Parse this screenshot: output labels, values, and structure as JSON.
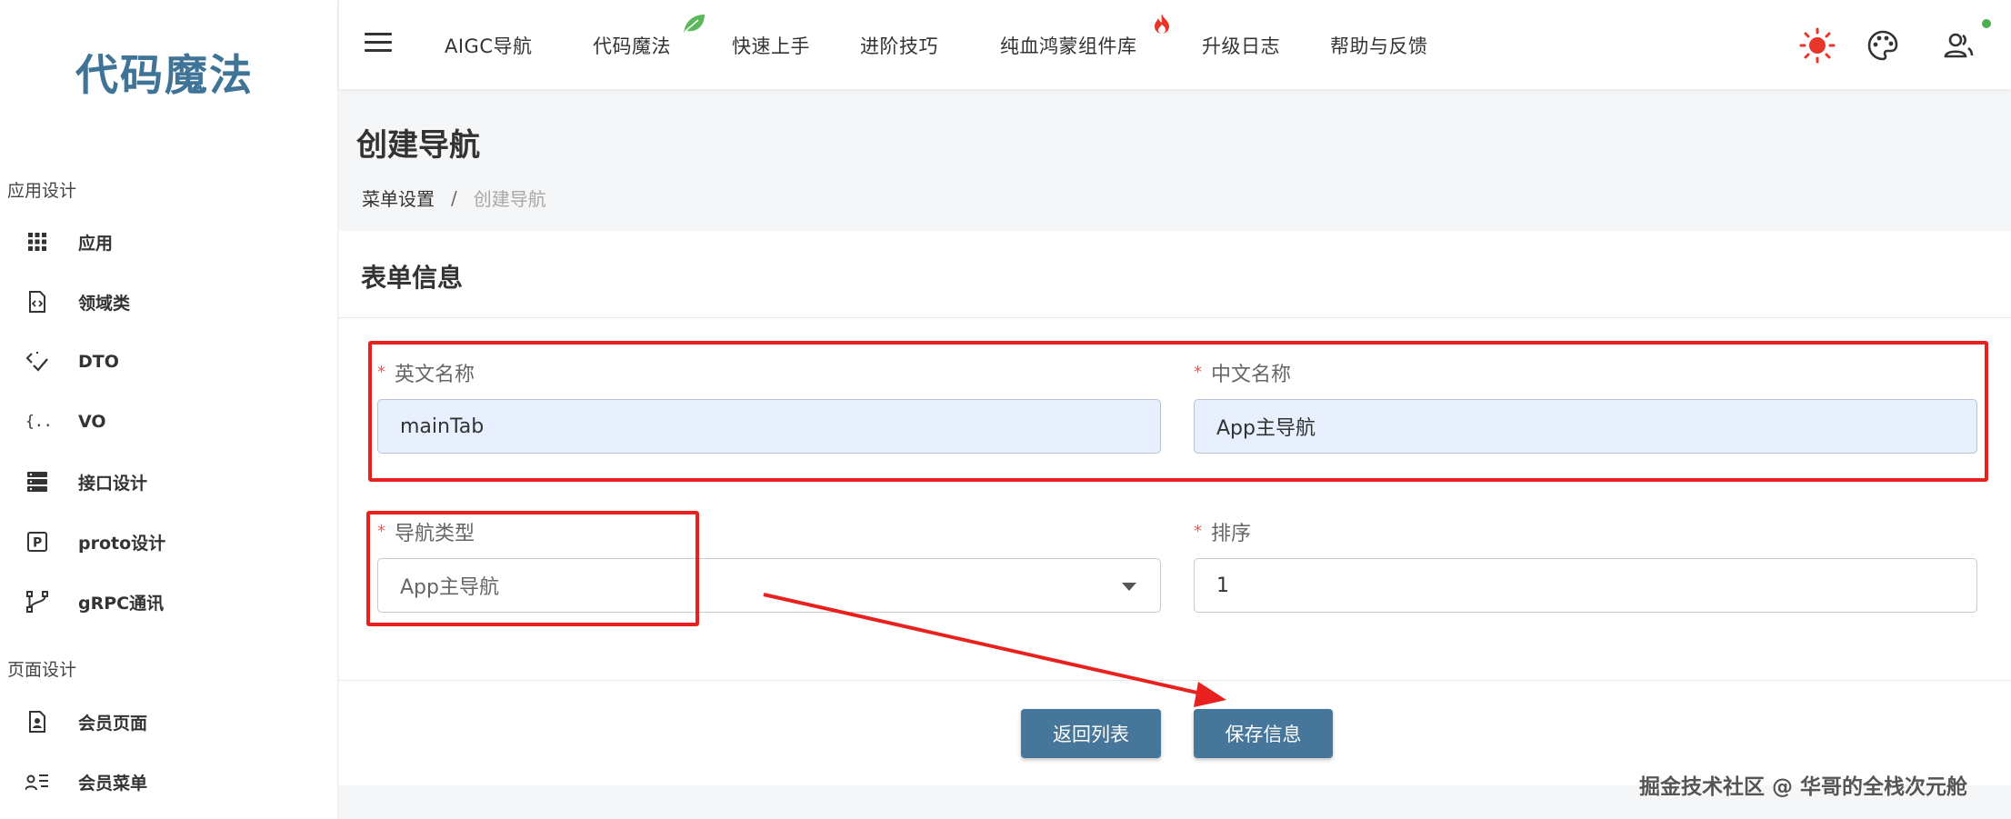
{
  "sidebar": {
    "logo": "代码魔法",
    "sections": [
      {
        "title": "应用设计",
        "items": [
          {
            "label": "应用",
            "icon": "grid-icon"
          },
          {
            "label": "领域类",
            "icon": "file-code-icon"
          },
          {
            "label": "DTO",
            "icon": "code-check-icon"
          },
          {
            "label": "VO",
            "icon": "braces-icon"
          },
          {
            "label": "接口设计",
            "icon": "server-icon"
          },
          {
            "label": "proto设计",
            "icon": "letter-p-icon"
          },
          {
            "label": "gRPC通讯",
            "icon": "branch-icon"
          }
        ]
      },
      {
        "title": "页面设计",
        "items": [
          {
            "label": "会员页面",
            "icon": "file-user-icon"
          },
          {
            "label": "会员菜单",
            "icon": "user-list-icon"
          }
        ]
      }
    ]
  },
  "topbar": {
    "menu_icon": "hamburger-icon",
    "items": [
      "AIGC导航",
      "代码魔法",
      "快速上手",
      "进阶技巧",
      "纯血鸿蒙组件库",
      "升级日志",
      "帮助与反馈"
    ],
    "badges": {
      "leaf_icon": "leaf-icon",
      "fire_icon": "fire-icon"
    },
    "right_icons": [
      "sun-icon",
      "palette-icon",
      "users-icon"
    ],
    "colors": {
      "sun": "#e8352a",
      "leaf": "#5cb85c",
      "online": "#4caf50"
    }
  },
  "page": {
    "title": "创建导航",
    "breadcrumb": {
      "parent": "菜单设置",
      "separator": "/",
      "current": "创建导航"
    }
  },
  "form": {
    "title": "表单信息",
    "required_mark": "*",
    "fields": {
      "en_name": {
        "label": "英文名称",
        "value": "mainTab"
      },
      "cn_name": {
        "label": "中文名称",
        "value": "App主导航"
      },
      "nav_type": {
        "label": "导航类型",
        "value": "App主导航"
      },
      "sort": {
        "label": "排序",
        "value": "1"
      }
    },
    "buttons": {
      "back": "返回列表",
      "save": "保存信息"
    }
  },
  "watermark": "掘金技术社区 @ 华哥的全栈次元舱",
  "colors": {
    "accent": "#46769a",
    "logo": "#3f7497",
    "annotation": "#e8201e",
    "filled_input": "#e8f0fe"
  }
}
